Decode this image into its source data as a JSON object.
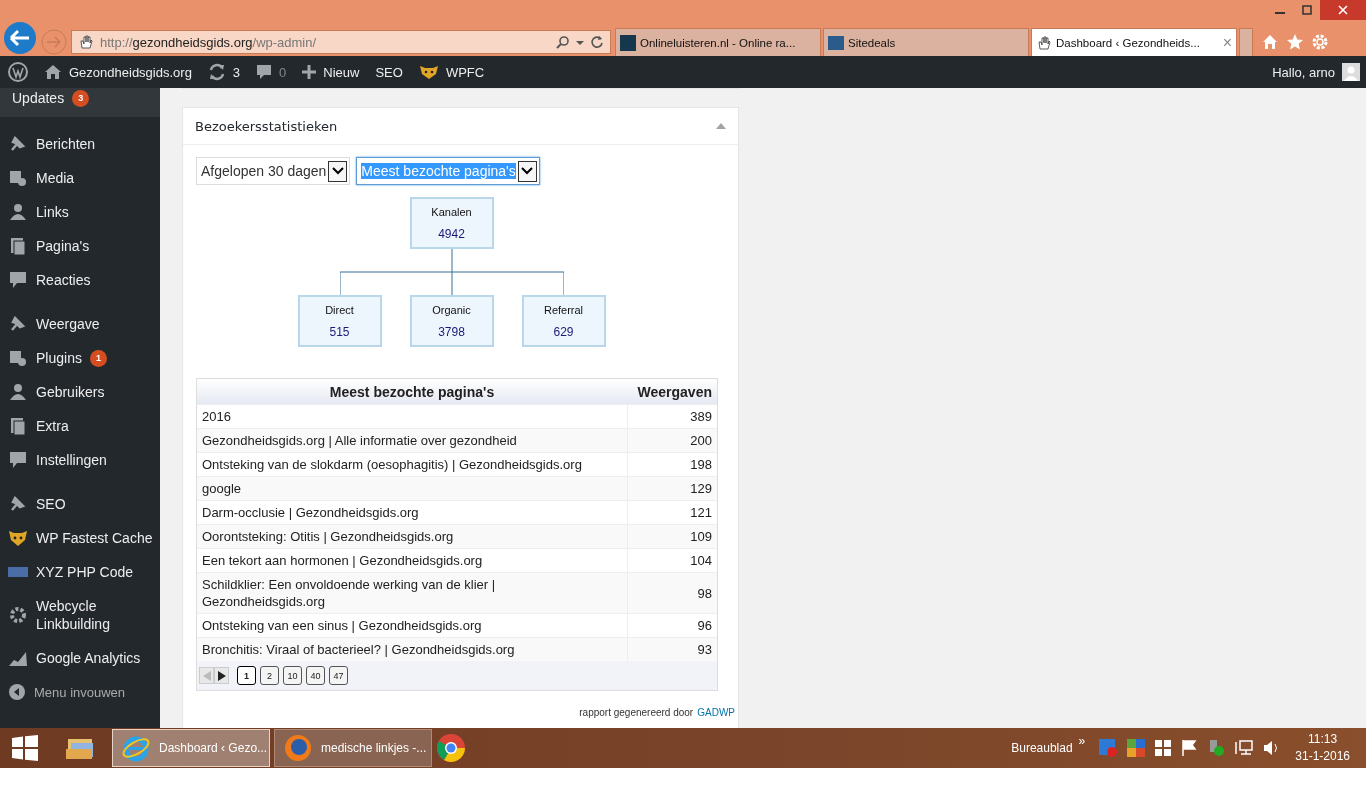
{
  "browser": {
    "address": {
      "prefix": "http://",
      "domain": "gezondheidsgids.org",
      "path": "/wp-admin/"
    },
    "tabs": [
      {
        "title": "Onlineluisteren.nl - Online ra...",
        "selected": false
      },
      {
        "title": "Sitedeals",
        "selected": false
      },
      {
        "title": "Dashboard ‹ Gezondheids...",
        "selected": true
      }
    ],
    "close_tab": "×"
  },
  "admin_bar": {
    "site": "Gezondheidsgids.org",
    "updates": "3",
    "comments": "0",
    "new": "Nieuw",
    "items": [
      "SEO",
      "WPFC"
    ],
    "greeting": "Hallo, arno"
  },
  "sidebar": {
    "groups": [
      [
        {
          "label": "Updates",
          "badge": "3"
        }
      ],
      [
        {
          "label": "Berichten"
        },
        {
          "label": "Media"
        },
        {
          "label": "Links"
        },
        {
          "label": "Pagina's"
        },
        {
          "label": "Reacties"
        }
      ],
      [
        {
          "label": "Weergave"
        },
        {
          "label": "Plugins",
          "badge": "1"
        },
        {
          "label": "Gebruikers"
        },
        {
          "label": "Extra"
        },
        {
          "label": "Instellingen"
        }
      ],
      [
        {
          "label": "SEO"
        },
        {
          "label": "WP Fastest Cache"
        },
        {
          "label": "XYZ PHP Code"
        },
        {
          "label": "Webcycle Linkbuilding"
        },
        {
          "label": "Google Analytics"
        }
      ]
    ],
    "collapse": "Menu invouwen"
  },
  "widget": {
    "title": "Bezoekersstatistieken",
    "selects": [
      {
        "value": "Afgelopen 30 dagen",
        "focused": false
      },
      {
        "value": "Meest bezochte pagina's",
        "focused": true
      }
    ],
    "org_chart": {
      "root": {
        "label": "Kanalen",
        "value": "4942"
      },
      "children": [
        {
          "label": "Direct",
          "value": "515"
        },
        {
          "label": "Organic",
          "value": "3798"
        },
        {
          "label": "Referral",
          "value": "629"
        }
      ]
    },
    "table": {
      "columns": [
        "Meest bezochte pagina's",
        "Weergaven"
      ],
      "rows": [
        {
          "page": "2016",
          "views": "389"
        },
        {
          "page": "Gezondheidsgids.org | Alle informatie over gezondheid",
          "views": "200"
        },
        {
          "page": "Ontsteking van de slokdarm (oesophagitis) | Gezondheidsgids.org",
          "views": "198"
        },
        {
          "page": "google",
          "views": "129"
        },
        {
          "page": "Darm-occlusie | Gezondheidsgids.org",
          "views": "121"
        },
        {
          "page": "Oorontsteking: Otitis | Gezondheidsgids.org",
          "views": "109"
        },
        {
          "page": "Een tekort aan hormonen | Gezondheidsgids.org",
          "views": "104"
        },
        {
          "page": "Schildklier: Een onvoldoende werking van de klier | Gezondheidsgids.org",
          "views": "98"
        },
        {
          "page": "Ontsteking van een sinus | Gezondheidsgids.org",
          "views": "96"
        },
        {
          "page": "Bronchitis: Viraal of bacterieel? | Gezondheidsgids.org",
          "views": "93"
        }
      ],
      "pages": [
        {
          "label": "1",
          "selected": true
        },
        {
          "label": "2",
          "selected": false
        },
        {
          "label": "10",
          "selected": false
        },
        {
          "label": "40",
          "selected": false
        },
        {
          "label": "47",
          "selected": false
        }
      ]
    },
    "footer": {
      "text": "rapport gegenereerd door",
      "link": "GADWP"
    }
  },
  "taskbar": {
    "items": [
      {
        "label": "Dashboard ‹ Gezo...",
        "selected": true
      },
      {
        "label": "medische linkjes -...",
        "selected": false
      }
    ],
    "desktop": "Bureaublad",
    "chevron": "»",
    "time": "11:13",
    "date": "31-1-2016"
  }
}
